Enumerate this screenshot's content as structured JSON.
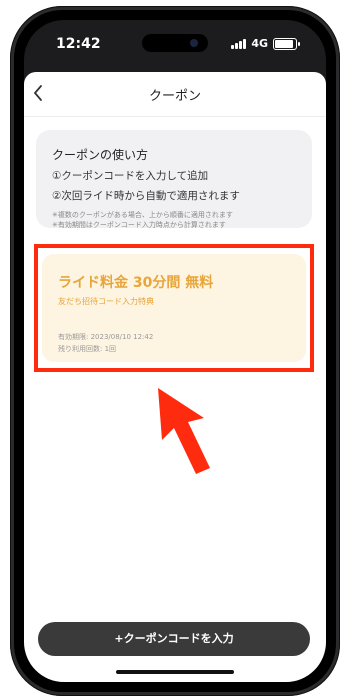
{
  "status_bar": {
    "time": "12:42",
    "network": "4G"
  },
  "nav": {
    "back_icon": "chevron-left-icon",
    "title": "クーポン"
  },
  "how_to": {
    "heading": "クーポンの使い方",
    "step1": "①クーポンコードを入力して追加",
    "step2": "②次回ライド時から自動で適用されます",
    "note1": "✳︎複数のクーポンがある場合、上から順番に適用されます",
    "note2": "✳︎有効期間はクーポンコード入力時点から計算されます"
  },
  "coupon": {
    "title": "ライド料金 30分間 無料",
    "subtitle": "友だち招待コード入力特典",
    "expiry": "有効期限: 2023/08/10 12:42",
    "remaining": "残り利用回数: 1回"
  },
  "annotation": {
    "highlight_color": "#ff2b0f",
    "arrow_icon": "pointer-arrow-icon"
  },
  "footer": {
    "enter_code_label": "+クーポンコードを入力"
  },
  "colors": {
    "accent": "#e8a53a",
    "coupon_bg": "#fdf4e2",
    "button_bg": "#3a3a3a"
  }
}
